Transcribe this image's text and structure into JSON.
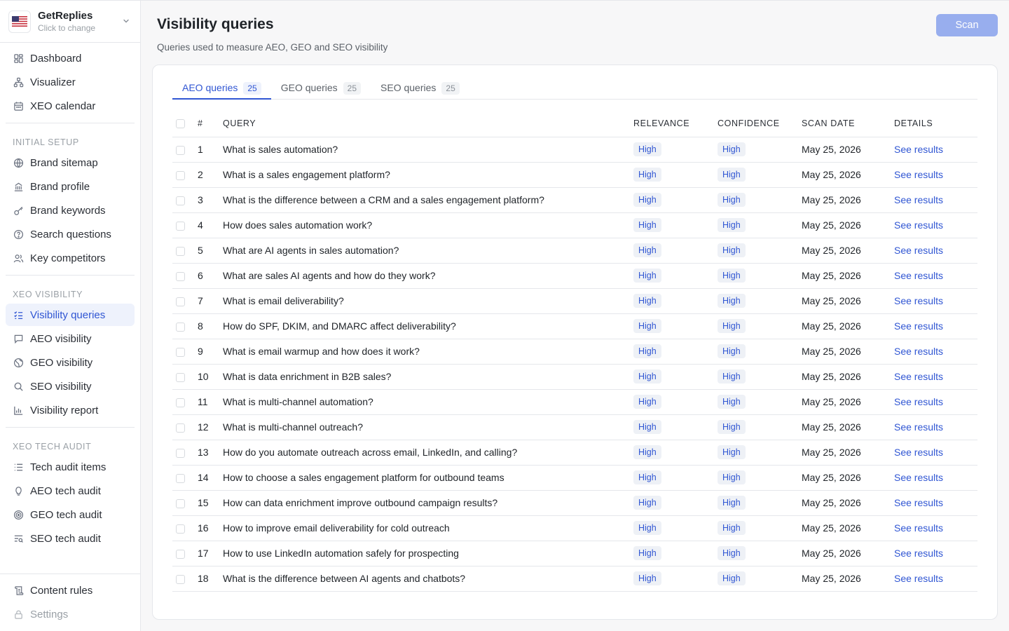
{
  "workspace": {
    "name": "GetReplies",
    "subtitle": "Click to change"
  },
  "sidebar": {
    "main_items": [
      {
        "label": "Dashboard",
        "icon": "dashboard-icon"
      },
      {
        "label": "Visualizer",
        "icon": "visualizer-icon"
      },
      {
        "label": "XEO calendar",
        "icon": "calendar-icon"
      }
    ],
    "sections": [
      {
        "title": "INITIAL SETUP",
        "items": [
          {
            "label": "Brand sitemap",
            "icon": "globe-icon"
          },
          {
            "label": "Brand profile",
            "icon": "building-icon"
          },
          {
            "label": "Brand keywords",
            "icon": "key-icon"
          },
          {
            "label": "Search questions",
            "icon": "question-circle-icon"
          },
          {
            "label": "Key competitors",
            "icon": "users-icon"
          }
        ]
      },
      {
        "title": "XEO VISIBILITY",
        "items": [
          {
            "label": "Visibility queries",
            "icon": "list-check-icon",
            "active": true
          },
          {
            "label": "AEO visibility",
            "icon": "chat-icon"
          },
          {
            "label": "GEO visibility",
            "icon": "geo-globe-icon"
          },
          {
            "label": "SEO visibility",
            "icon": "search-icon"
          },
          {
            "label": "Visibility report",
            "icon": "bar-chart-icon"
          }
        ]
      },
      {
        "title": "XEO TECH AUDIT",
        "items": [
          {
            "label": "Tech audit items",
            "icon": "list-icon"
          },
          {
            "label": "AEO tech audit",
            "icon": "bulb-icon"
          },
          {
            "label": "GEO tech audit",
            "icon": "target-icon"
          },
          {
            "label": "SEO tech audit",
            "icon": "list-search-icon"
          }
        ]
      }
    ],
    "bottom_items": [
      {
        "label": "Content rules",
        "icon": "scroll-icon"
      },
      {
        "label": "Settings",
        "icon": "lock-icon",
        "muted": true
      }
    ]
  },
  "page": {
    "title": "Visibility queries",
    "subtitle": "Queries used to measure AEO, GEO and SEO visibility",
    "scan_label": "Scan"
  },
  "tabs": [
    {
      "label": "AEO queries",
      "count": "25",
      "active": true
    },
    {
      "label": "GEO queries",
      "count": "25"
    },
    {
      "label": "SEO queries",
      "count": "25"
    }
  ],
  "table": {
    "columns": [
      "#",
      "QUERY",
      "RELEVANCE",
      "CONFIDENCE",
      "SCAN DATE",
      "DETAILS"
    ],
    "rows": [
      {
        "num": "1",
        "query": "What is sales automation?",
        "relevance": "High",
        "confidence": "High",
        "date": "May 25, 2026",
        "details": "See results"
      },
      {
        "num": "2",
        "query": "What is a sales engagement platform?",
        "relevance": "High",
        "confidence": "High",
        "date": "May 25, 2026",
        "details": "See results"
      },
      {
        "num": "3",
        "query": "What is the difference between a CRM and a sales engagement platform?",
        "relevance": "High",
        "confidence": "High",
        "date": "May 25, 2026",
        "details": "See results"
      },
      {
        "num": "4",
        "query": "How does sales automation work?",
        "relevance": "High",
        "confidence": "High",
        "date": "May 25, 2026",
        "details": "See results"
      },
      {
        "num": "5",
        "query": "What are AI agents in sales automation?",
        "relevance": "High",
        "confidence": "High",
        "date": "May 25, 2026",
        "details": "See results"
      },
      {
        "num": "6",
        "query": "What are sales AI agents and how do they work?",
        "relevance": "High",
        "confidence": "High",
        "date": "May 25, 2026",
        "details": "See results"
      },
      {
        "num": "7",
        "query": "What is email deliverability?",
        "relevance": "High",
        "confidence": "High",
        "date": "May 25, 2026",
        "details": "See results"
      },
      {
        "num": "8",
        "query": "How do SPF, DKIM, and DMARC affect deliverability?",
        "relevance": "High",
        "confidence": "High",
        "date": "May 25, 2026",
        "details": "See results"
      },
      {
        "num": "9",
        "query": "What is email warmup and how does it work?",
        "relevance": "High",
        "confidence": "High",
        "date": "May 25, 2026",
        "details": "See results"
      },
      {
        "num": "10",
        "query": "What is data enrichment in B2B sales?",
        "relevance": "High",
        "confidence": "High",
        "date": "May 25, 2026",
        "details": "See results"
      },
      {
        "num": "11",
        "query": "What is multi-channel automation?",
        "relevance": "High",
        "confidence": "High",
        "date": "May 25, 2026",
        "details": "See results"
      },
      {
        "num": "12",
        "query": "What is multi-channel outreach?",
        "relevance": "High",
        "confidence": "High",
        "date": "May 25, 2026",
        "details": "See results"
      },
      {
        "num": "13",
        "query": "How do you automate outreach across email, LinkedIn, and calling?",
        "relevance": "High",
        "confidence": "High",
        "date": "May 25, 2026",
        "details": "See results"
      },
      {
        "num": "14",
        "query": "How to choose a sales engagement platform for outbound teams",
        "relevance": "High",
        "confidence": "High",
        "date": "May 25, 2026",
        "details": "See results"
      },
      {
        "num": "15",
        "query": "How can data enrichment improve outbound campaign results?",
        "relevance": "High",
        "confidence": "High",
        "date": "May 25, 2026",
        "details": "See results"
      },
      {
        "num": "16",
        "query": "How to improve email deliverability for cold outreach",
        "relevance": "High",
        "confidence": "High",
        "date": "May 25, 2026",
        "details": "See results"
      },
      {
        "num": "17",
        "query": "How to use LinkedIn automation safely for prospecting",
        "relevance": "High",
        "confidence": "High",
        "date": "May 25, 2026",
        "details": "See results"
      },
      {
        "num": "18",
        "query": "What is the difference between AI agents and chatbots?",
        "relevance": "High",
        "confidence": "High",
        "date": "May 25, 2026",
        "details": "See results"
      }
    ]
  }
}
